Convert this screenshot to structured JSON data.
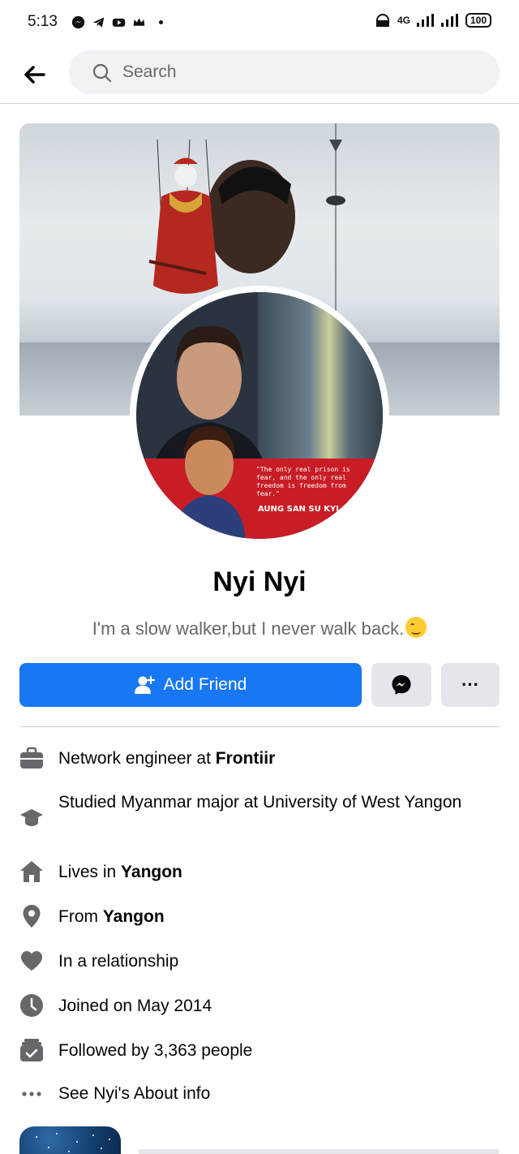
{
  "status_bar": {
    "time": "5:13",
    "network": "4G",
    "battery": "100"
  },
  "search": {
    "placeholder": "Search"
  },
  "profile": {
    "name": "Nyi Nyi",
    "bio": "I'm a slow walker,but I never walk back.",
    "avatar_quote": "\"The only real prison is fear, and the only real freedom is freedom from fear.\"",
    "avatar_caption": "AUNG SAN SU KYI"
  },
  "actions": {
    "add_friend": "Add Friend",
    "more": "···"
  },
  "details": [
    {
      "icon": "briefcase-icon",
      "prefix": "Network engineer at ",
      "bold": "Frontiir"
    },
    {
      "icon": "graduation-cap-icon",
      "prefix": "Studied Myanmar major at University of West Yangon",
      "bold": ""
    },
    {
      "icon": "home-icon",
      "prefix": "Lives in ",
      "bold": "Yangon"
    },
    {
      "icon": "location-pin-icon",
      "prefix": "From ",
      "bold": "Yangon"
    },
    {
      "icon": "heart-icon",
      "prefix": "In a relationship",
      "bold": ""
    },
    {
      "icon": "clock-icon",
      "prefix": "Joined on May 2014",
      "bold": ""
    },
    {
      "icon": "followers-icon",
      "prefix": "Followed by 3,363 people",
      "bold": ""
    },
    {
      "icon": "more-dots-icon",
      "prefix": "See Nyi's About info",
      "bold": ""
    }
  ],
  "colors": {
    "primary": "#1877f2",
    "secondary_button": "#e4e6eb",
    "search_bg": "#f0f2f5",
    "text_secondary": "#65676b",
    "icon_gray": "#65676b"
  }
}
